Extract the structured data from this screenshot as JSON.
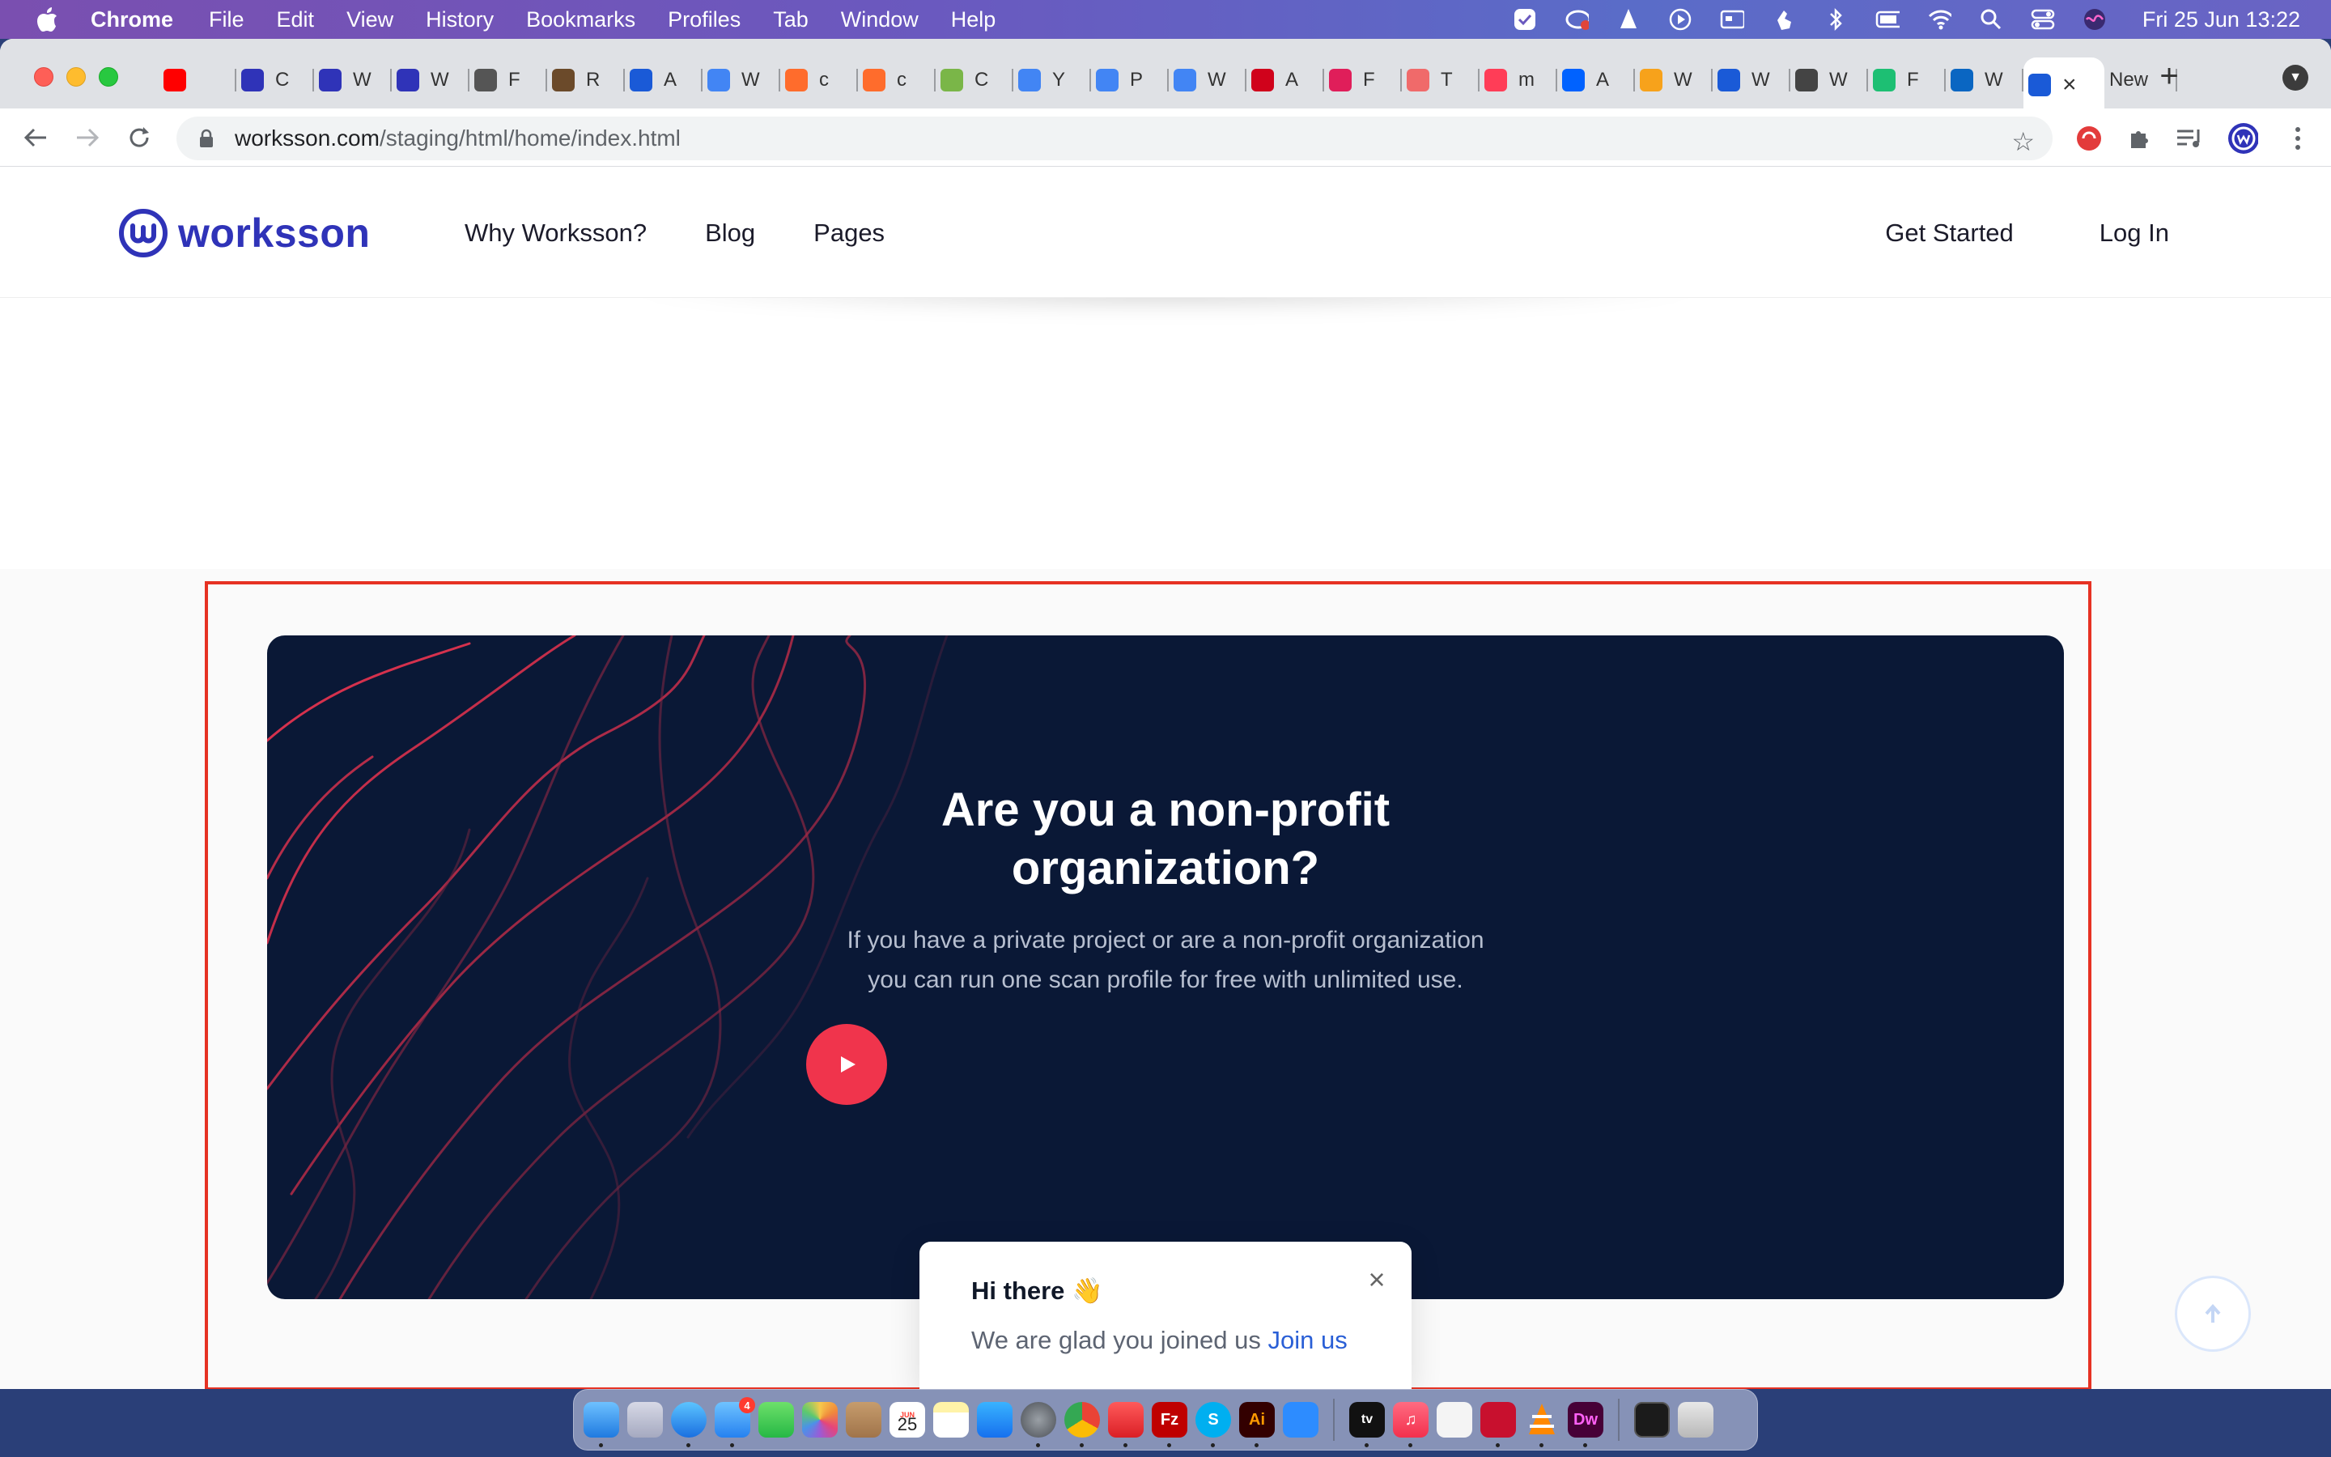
{
  "menubar": {
    "app_name": "Chrome",
    "items": [
      "File",
      "Edit",
      "View",
      "History",
      "Bookmarks",
      "Profiles",
      "Tab",
      "Window",
      "Help"
    ],
    "clock": "Fri 25 Jun  13:22"
  },
  "browser": {
    "tabs": [
      {
        "letter": "",
        "color": "#ff0000",
        "icon": "youtube-icon"
      },
      {
        "letter": "C",
        "color": "#2f33b8",
        "icon": "worksson-icon"
      },
      {
        "letter": "W",
        "color": "#2f33b8",
        "icon": "worksson-icon"
      },
      {
        "letter": "W",
        "color": "#2f33b8",
        "icon": "worksson-icon"
      },
      {
        "letter": "F",
        "color": "#555555",
        "icon": "feather-icon"
      },
      {
        "letter": "R",
        "color": "#6b4a2a",
        "icon": "photo-icon"
      },
      {
        "letter": "A",
        "color": "#1a5ad7",
        "icon": "bookmark-icon"
      },
      {
        "letter": "W",
        "color": "#4285f4",
        "icon": "docs-icon"
      },
      {
        "letter": "c",
        "color": "#ff6c2c",
        "icon": "cpanel-icon"
      },
      {
        "letter": "c",
        "color": "#ff6c2c",
        "icon": "cpanel-icon"
      },
      {
        "letter": "C",
        "color": "#7ab648",
        "icon": "q-icon"
      },
      {
        "letter": "Y",
        "color": "#4285f4",
        "icon": "docs-icon"
      },
      {
        "letter": "P",
        "color": "#4285f4",
        "icon": "docs-icon"
      },
      {
        "letter": "W",
        "color": "#4285f4",
        "icon": "docs-icon"
      },
      {
        "letter": "A",
        "color": "#d0021b",
        "icon": "all-icon"
      },
      {
        "letter": "F",
        "color": "#e01e5a",
        "icon": "slack-icon"
      },
      {
        "letter": "T",
        "color": "#f06a6a",
        "icon": "asana-icon"
      },
      {
        "letter": "m",
        "color": "#ff3d57",
        "icon": "monday-icon"
      },
      {
        "letter": "A",
        "color": "#0062ff",
        "icon": "a-icon"
      },
      {
        "letter": "W",
        "color": "#f7a21b",
        "icon": "swirl-icon"
      },
      {
        "letter": "W",
        "color": "#1a5ad7",
        "icon": "bookmark-icon"
      },
      {
        "letter": "W",
        "color": "#444444",
        "icon": "globe-icon"
      },
      {
        "letter": "F",
        "color": "#1dbf73",
        "icon": "fiverr-icon"
      },
      {
        "letter": "W",
        "color": "#0a66c2",
        "icon": "linkedin-icon"
      }
    ],
    "active_tab_close": "×",
    "new_tab_label": "New",
    "url_host": "worksson.com",
    "url_path": "/staging/html/home/index.html"
  },
  "site": {
    "logo_text": "worksson",
    "nav": [
      "Why Worksson?",
      "Blog",
      "Pages"
    ],
    "get_started": "Get Started",
    "login": "Log In"
  },
  "cta": {
    "title_line1": "Are you a non-profit",
    "title_line2": "organization?",
    "desc_line1": "If you have a private project or are a non-profit organization",
    "desc_line2": "you can run one scan profile for free with unlimited use."
  },
  "chat": {
    "greeting": "Hi there 👋",
    "message": "We are glad you joined us ",
    "link": "Join us",
    "close": "×"
  },
  "dock": {
    "calendar_month": "JUN",
    "calendar_day": "25",
    "mail_badge": "4",
    "apps": [
      "finder",
      "launchpad",
      "safari",
      "mail",
      "facetime",
      "photos",
      "contacts",
      "calendar",
      "notes",
      "app-store",
      "settings",
      "chrome",
      "creative-cloud",
      "filezilla",
      "skype",
      "illustrator",
      "zoom",
      "apple-tv",
      "music",
      "textedit",
      "acrobat",
      "vlc",
      "dreamweaver"
    ],
    "labels": {
      "tv": "tv",
      "ai": "Ai",
      "dw": "Dw",
      "s": "S"
    }
  }
}
